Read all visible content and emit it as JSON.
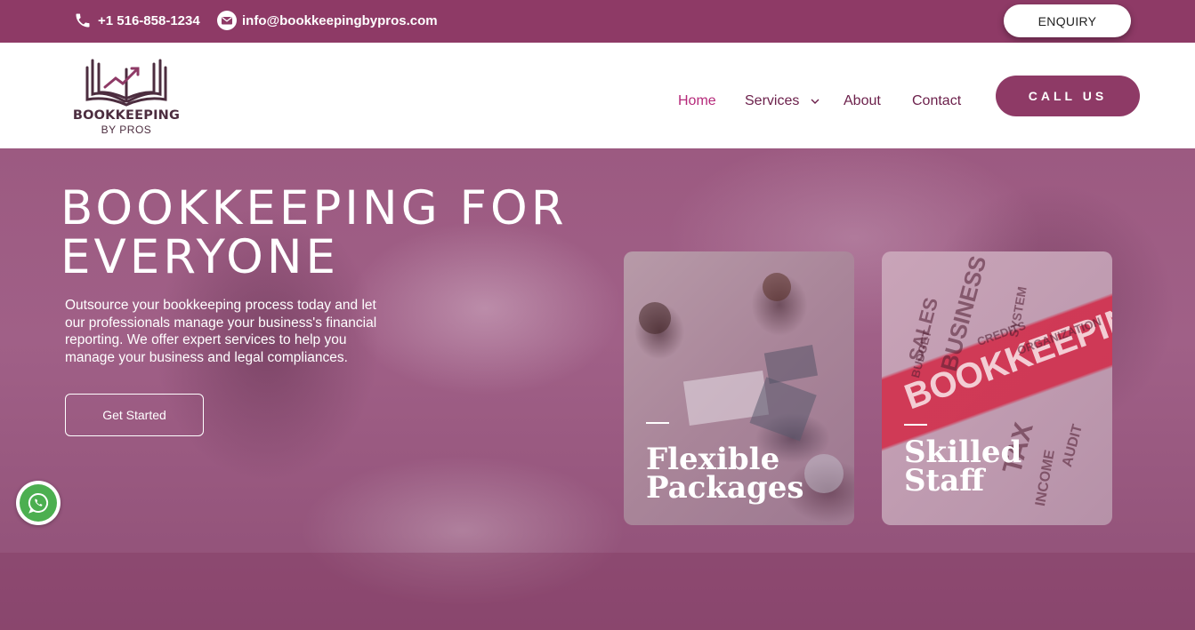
{
  "topbar": {
    "phone": "+1 516-858-1234",
    "email": "info@bookkeepingbypros.com",
    "enquiry_label": "ENQUIRY"
  },
  "header": {
    "logo": {
      "brand": "BOOKKEEPING",
      "sub": "BY PROS"
    },
    "nav": [
      {
        "label": "Home",
        "active": true
      },
      {
        "label": "Services",
        "has_dropdown": true
      },
      {
        "label": "About"
      },
      {
        "label": "Contact"
      }
    ],
    "cta_label": "CALL US"
  },
  "hero": {
    "title_line1": "BOOKKEEPING FOR",
    "title_line2": "EVERYONE",
    "description_lines": [
      "Outsource your bookkeeping process today and let",
      "our professionals manage your business's financial",
      "reporting. We offer expert services to help you",
      "manage your business and legal compliances."
    ],
    "button_label": "Get Started",
    "cards": [
      {
        "line1": "Flexible",
        "line2": "Packages"
      },
      {
        "line1": "Skilled",
        "line2": "Staff"
      }
    ],
    "wordcloud": [
      "BOOKKEEPIN",
      "BUSINESS",
      "SALES",
      "TAX",
      "AUDIT",
      "INCOME",
      "BUDGET",
      "SYSTEM",
      "CREDITS",
      "ORGANIZATION"
    ]
  },
  "colors": {
    "brand": "#8e3a66",
    "nav_text": "#6b1f4a",
    "nav_active": "#b5297a",
    "whatsapp": "#4caf50"
  },
  "icons": [
    "phone-icon",
    "mail-icon",
    "chevron-down-icon",
    "whatsapp-icon",
    "logo-book-icon"
  ]
}
